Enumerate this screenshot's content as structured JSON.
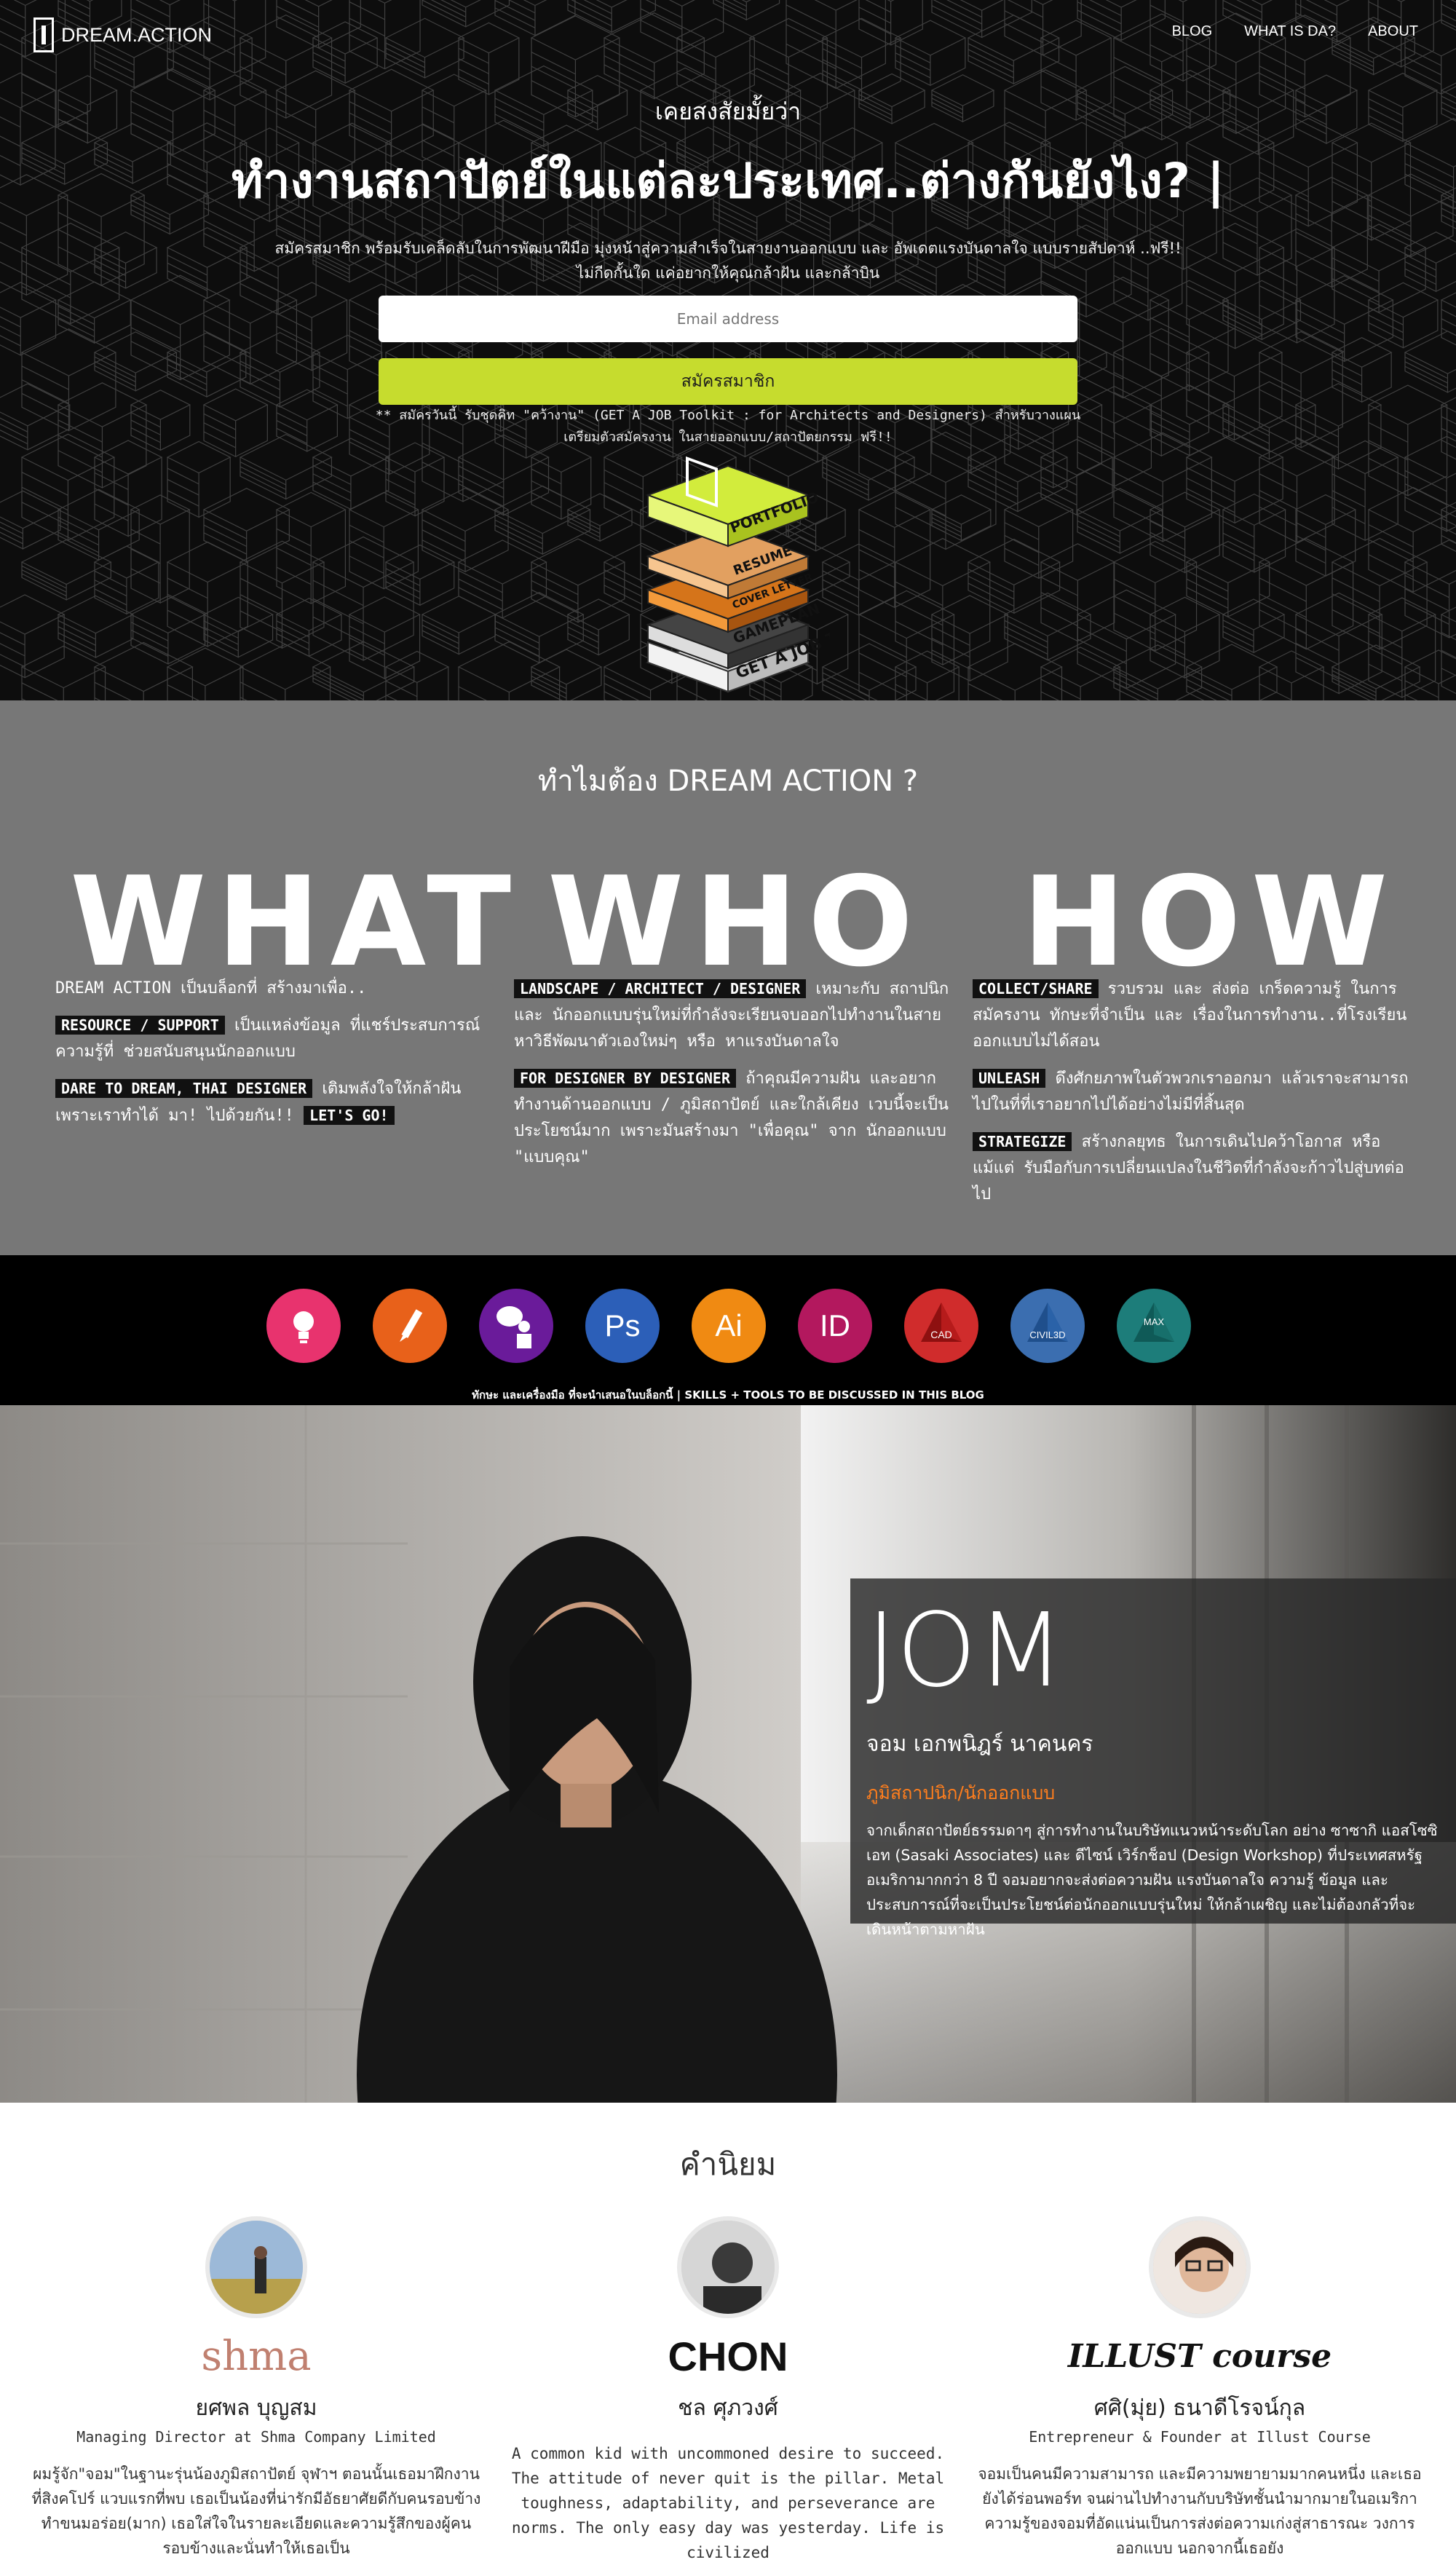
{
  "nav": {
    "logo_text": "DREAM.ACTION",
    "links": [
      "BLOG",
      "WHAT IS DA?",
      "ABOUT"
    ]
  },
  "hero": {
    "kicker": "เคยสงสัยมั้ยว่า",
    "title": "ทำงานสถาปัตย์ในแต่ละประเทศ..ต่างกันยังไง? |",
    "desc_line1": "สมัครสมาชิก พร้อมรับเคล็ดลับในการพัฒนาฝีมือ มุ่งหน้าสู่ความสำเร็จในสายงานออกแบบ และ อัพเดตแรงบันดาลใจ แบบรายสัปดาห์ ..ฟรี!!",
    "desc_line2": "ไม่กีดกั้นใด แค่อยากให้คุณกล้าฝัน และกล้าบิน",
    "email_placeholder": "Email address",
    "subscribe_label": "สมัครสมาชิก",
    "note_line1": "** สมัครวันนี้ รับชุดคิท \"คว้างาน\" (GET A JOB Toolkit : for Architects and Designers) สำหรับวางแผน",
    "note_line2": "เตรียมตัวสมัครงาน ในสายออกแบบ/สถาปัตยกรรม ฟรี!!",
    "toolkit_layers": [
      "PORTFOLIO",
      "RESUME",
      "COVER LETTER",
      "GAMEPLAN",
      "GET A JOB TOOLKIT"
    ]
  },
  "why": {
    "title": "ทำไมต้อง DREAM ACTION ?",
    "words": [
      "WHAT",
      "WHO",
      "HOW"
    ],
    "what": {
      "intro": "DREAM ACTION เป็นบล็อกที่ สร้างมาเพื่อ..",
      "tag1": "RESOURCE / SUPPORT",
      "text1": " เป็นแหล่งข้อมูล ที่แชร์ประสบการณ์ ความรู้ที่ ช่วยสนับสนุนนักออกแบบ",
      "tag2": "DARE TO DREAM, THAI DESIGNER",
      "text2": " เติมพลังใจให้กล้าฝัน เพราะเราทำได้ มา! ไปด้วยกัน!! ",
      "tag3": "LET'S GO!"
    },
    "who": {
      "tag1": "LANDSCAPE / ARCHITECT / DESIGNER",
      "text1": " เหมาะกับ สถาปนิก และ นักออกแบบรุ่นใหม่ที่กำลังจะเรียนจบออกไปทำงานในสาย หาวิธีพัฒนาตัวเองใหม่ๆ หรือ หาแรงบันดาลใจ",
      "tag2": "FOR DESIGNER BY DESIGNER",
      "text2": " ถ้าคุณมีความฝัน และอยากทำงานด้านออกแบบ / ภูมิสถาปัตย์ และใกล้เคียง เวบนี้จะเป็นประโยชน์มาก เพราะมันสร้างมา \"เพื่อคุณ\" จาก นักออกแบบ \"แบบคุณ\""
    },
    "how": {
      "tag1": "COLLECT/SHARE",
      "text1": " รวบรวม และ ส่งต่อ เกร็ดความรู้ ในการสมัครงาน ทักษะที่จำเป็น และ เรื่องในการทำงาน..ที่โรงเรียนออกแบบไม่ได้สอน",
      "tag2": "UNLEASH",
      "text2": " ดึงศักยภาพในตัวพวกเราออกมา แล้วเราจะสามารถไปในที่ที่เราอยากไปได้อย่างไม่มีที่สิ้นสุด",
      "tag3": "STRATEGIZE",
      "text3": " สร้างกลยุทธ ในการเดินไปคว้าโอกาส หรือ แม้แต่ รับมือกับการเปลี่ยนแปลงในชีวิตที่กำลังจะก้าวไปสู่บทต่อไป"
    }
  },
  "tools": {
    "items": [
      {
        "icon": "lightbulb-icon",
        "label": "",
        "color": "#e8336e"
      },
      {
        "icon": "pencil-icon",
        "label": "",
        "color": "#e8611a"
      },
      {
        "icon": "speech-person-icon",
        "label": "",
        "color": "#6a1b9a"
      },
      {
        "icon": "photoshop-icon",
        "label": "Ps",
        "color": "#2c5fb8"
      },
      {
        "icon": "illustrator-icon",
        "label": "Ai",
        "color": "#f08a12"
      },
      {
        "icon": "indesign-icon",
        "label": "ID",
        "color": "#b3185e"
      },
      {
        "icon": "autocad-icon",
        "label": "CAD",
        "color": "#d02c2c"
      },
      {
        "icon": "civil3d-icon",
        "label": "CIVIL3D",
        "color": "#3b6eb0"
      },
      {
        "icon": "3dsmax-icon",
        "label": "MAX",
        "color": "#1d7d7a"
      }
    ],
    "caption": "ทักษะ และเครื่องมือ ที่จะนำเสนอในบล็อกนี้ | SKILLS + TOOLS TO BE DISCUSSED IN THIS BLOG"
  },
  "jom": {
    "name": "JOM",
    "thai_name": "จอม เอกพนิฎร์ นาคนคร",
    "role": "ภูมิสถาปนิก/นักออกแบบ",
    "bio": "จากเด็กสถาปัตย์ธรรมดาๆ สู่การทำงานในบริษัทแนวหน้าระดับโลก อย่าง ซาซากิ แอสโซซิเอท (Sasaki Associates) และ ดีไซน์ เวิร์กช็อป (Design Workshop) ที่ประเทศสหรัฐ อเมริกามากกว่า 8 ปี จอมอยากจะส่งต่อความฝัน แรงบันดาลใจ ความรู้ ข้อมูล และ ประสบการณ์ที่จะเป็นประโยชน์ต่อนักออกแบบรุ่นใหม่ ให้กล้าเผชิญ และไม่ต้องกลัวที่จะเดินหน้าตามหาฝัน"
  },
  "testimonials": {
    "title": "คำนิยม",
    "people": [
      {
        "brand": "shma",
        "name": "ยศพล บุญสม",
        "role": "Managing Director at Shma Company Limited",
        "quote": "ผมรู้จัก\"จอม\"ในฐานะรุ่นน้องภูมิสถาปัตย์ จุฬาฯ ตอนนั้นเธอมาฝึกงานที่สิงคโปร์ แวบแรกที่พบ เธอเป็นน้องที่น่ารักมีอัธยาศัยดีกับคนรอบข้าง ทำขนมอร่อย(มาก) เธอใส่ใจในรายละเอียดและความรู้สึกของผู้คนรอบข้างและนั่นทำให้เธอเป็น"
      },
      {
        "brand": "CHON",
        "name": "ชล ศุภวงศ์",
        "role": "",
        "quote": "A common kid with uncommoned desire to succeed. The attitude of never quit is the pillar. Metal toughness, adaptability, and perseverance are norms. The only easy day was yesterday. Life is civilized"
      },
      {
        "brand": "ILLUST course",
        "name": "ศศิ(มุ่ย) ธนาดีโรจน์กุล",
        "role": "Entrepreneur & Founder at Illust Course",
        "quote": "จอมเป็นคนมีความสามารถ และมีความพยายามมากคนหนึ่ง และเธอยังได้ร่อนพอร์ท จนผ่านไปทำงานกับบริษัทชั้นนำมากมายในอเมริกา ความรู้ของจอมที่อัดแน่นเป็นการส่งต่อความเก่งสู่สาธารณะ วงการออกแบบ นอกจากนี้เธอยัง"
      }
    ]
  }
}
